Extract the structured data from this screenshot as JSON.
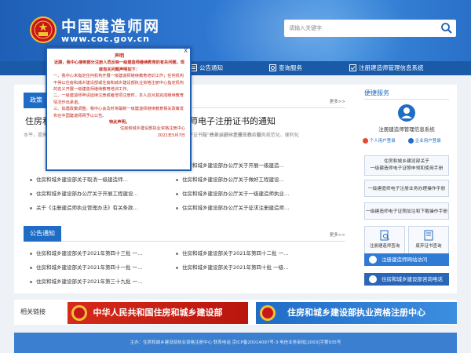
{
  "header": {
    "title": "中国建造师网",
    "url": "www.coc.gov.cn",
    "search_placeholder": "请输入关键字"
  },
  "nav": {
    "items": [
      {
        "label": "公告通知"
      },
      {
        "label": "查询服务"
      },
      {
        "label": "注册建造师管理信息系统"
      }
    ]
  },
  "policy": {
    "tab": "政策",
    "more": "更多>>",
    "headline": "住房和城乡建设部办公厅关于启用一级建造师电子注册证书的通知",
    "summary": "水平，提高注册管理效率，我部决定启用一级建造师电子注册证书（以下简称电子证书），并开展延续注册工作。现",
    "summary_fragment": "服\"改革，进一步提升政务服务规范化、便利化",
    "left_items": [
      "住房和城乡建设部关于取消一级建造师…",
      "住房和城乡建设部办公厅关于开展工程建设…",
      "关于《注册建造师执业管理办法》有关条款…"
    ],
    "right_items": [
      "住房和城乡建设部办公厅关于开展一级建造…",
      "住房和城乡建设部办公厅关于做好工程建设…",
      "住房和城乡建设部办公厅关于一级建造师执业…",
      "住房和城乡建设部办公厅关于征求注册建造师…"
    ]
  },
  "notices": {
    "tab": "公告通知",
    "more": "更多>>",
    "left_items": [
      "住房和城乡建设部关于2021年第四十三批 一…",
      "住房和城乡建设部关于2021年第四十一批 一…",
      "住房和城乡建设部关于2021年第三十九批 一…"
    ],
    "right_items": [
      "住房和城乡建设部关于2021年第四十二批 一…",
      "住房和城乡建设部关于2021年第四十批 一级…"
    ]
  },
  "services": {
    "title": "便捷服务",
    "system_label": "注册建造师管理信息系统",
    "personal_login": "个人用户登录",
    "enterprise_login": "企业用户登录",
    "buttons": [
      "住房和城乡建设部关于\n一级建造师电子证照申领和使用手册",
      "一级建造师电子注册业务办理操作手册",
      "一级建造师电子证照加注和下载操作手册"
    ],
    "cards": [
      "注册建造师查询",
      "废弃证书查询"
    ],
    "bars": [
      "注册建造师网站访问",
      "住房和城乡建设部咨询电话"
    ]
  },
  "links": {
    "label": "相关链接",
    "banner1": "中华人民共和国住房和城乡建设部",
    "banner2": "住房和城乡建设部执业资格注册中心"
  },
  "footer": {
    "text": "主办：住房和城乡建设部执业资格注册中心 联系电话 京ICP备20014097号-3 电信业务审批[2003]字第935号"
  },
  "popup": {
    "close": "X",
    "title": "声明",
    "intro": "近期，我中心接到部分注册人员反映一级建造师继续教育的有关问题，现就有关问题声明如下：",
    "p1": "一、我中心未指定任何机构开展一级建造师继续教育培训工作；任何机构不得以住房和城乡建设部或住房和城乡建设部执业资格注册中心指定机构的名义开展一级建造师继续教育培训工作。",
    "p2": "二、一级建造师申请延续注册或者增项注册时，本人应对其完成继续教育情况作出承诺。",
    "p3": "三、如遇政策调整，我中心会及时将最新一级建造师继续教育相关政策发布在中国建造师网予以公告。",
    "notice": "特此声明。",
    "signature": "住房和城乡建设部执业资格注册中心",
    "date": "2021年5月7日"
  },
  "colors": {
    "header_blue": "#2f78d2",
    "nav_blue": "#1b5aa7",
    "tab_blue": "#1f6cc7",
    "banner_red": "#c62014",
    "popup_red": "#c0271c"
  }
}
